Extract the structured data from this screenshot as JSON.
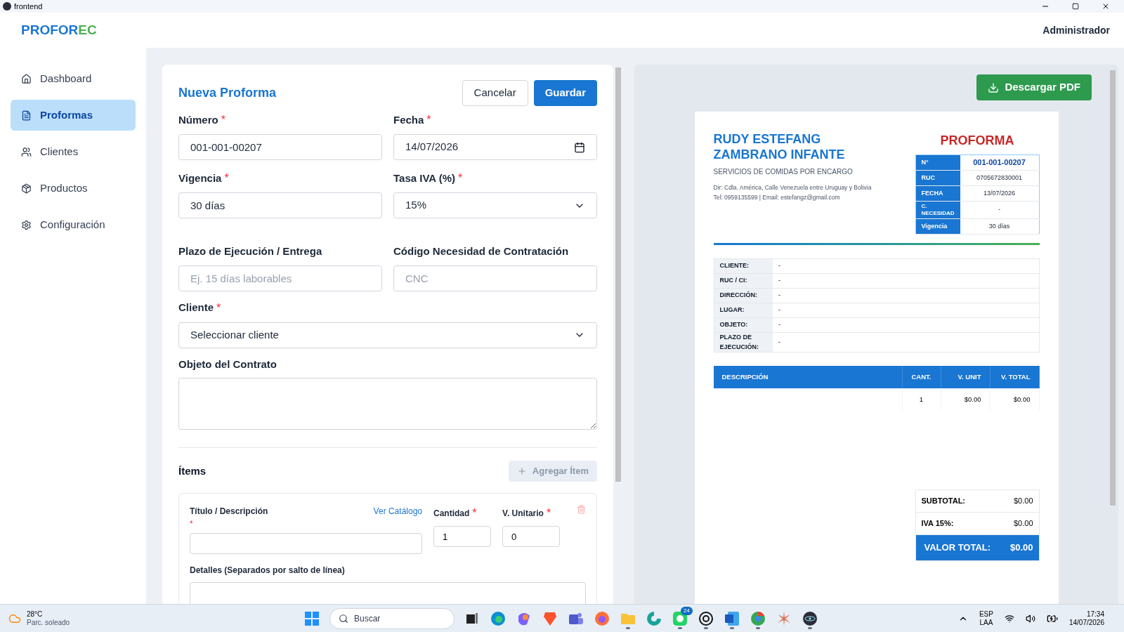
{
  "window": {
    "title": "frontend"
  },
  "app": {
    "logo_main": "PROFOR",
    "logo_accent": "EC",
    "user": "Administrador"
  },
  "sidebar": {
    "items": [
      {
        "label": "Dashboard",
        "kind": "home",
        "selected": false
      },
      {
        "label": "Proformas",
        "kind": "file",
        "selected": true
      },
      {
        "label": "Clientes",
        "kind": "users",
        "selected": false
      },
      {
        "label": "Productos",
        "kind": "box",
        "selected": false
      },
      {
        "label": "Configuración",
        "kind": "gear",
        "selected": false
      }
    ]
  },
  "form": {
    "title": "Nueva Proforma",
    "cancel": "Cancelar",
    "save": "Guardar",
    "fields": [
      {
        "label": "Número",
        "required_mark": "*",
        "kind": "text",
        "value": "001-001-00207"
      },
      {
        "label": "Fecha",
        "required_mark": "*",
        "kind": "date",
        "value": "14/07/2026"
      },
      {
        "label": "Vigencia",
        "required_mark": "*",
        "kind": "text",
        "value": "30 días"
      },
      {
        "label": "Tasa IVA (%)",
        "required_mark": "*",
        "kind": "select",
        "value": "15%"
      },
      {
        "label": "Plazo de Ejecución / Entrega",
        "kind": "text",
        "placeholder": "Ej. 15 días laborables"
      },
      {
        "label": "Código Necesidad de Contratación",
        "kind": "text",
        "placeholder": "CNC"
      }
    ],
    "client": {
      "label": "Cliente",
      "required_mark": "*",
      "value": "Seleccionar cliente"
    },
    "object": {
      "label": "Objeto del Contrato"
    },
    "items_title": "Ítems",
    "add_item": {
      "label": "Agregar Ítem",
      "disabled": true
    },
    "item": {
      "title_label": "Título / Descripción",
      "title_mark": "*",
      "catalog": "Ver Catálogo",
      "qty_label": "Cantidad",
      "qty_mark": "*",
      "qty": "1",
      "price_label": "V. Unitario",
      "price_mark": "*",
      "price": "0",
      "details_label": "Detalles (Separados por salto de línea)"
    }
  },
  "preview": {
    "download": "Descargar PDF",
    "company": {
      "name": "RUDY ESTEFANG ZAMBRANO INFANTE",
      "activity": "SERVICIOS DE COMIDAS POR ENCARGO",
      "address": "Dir: Cdla. América, Calle Venezuela entre Uruguay y Bolivia",
      "contact": "Tel: 0959135599 | Email: estefangz@gmail.com"
    },
    "doc_title": "PROFORMA",
    "meta": [
      {
        "label": "N°",
        "value": "001-001-00207",
        "kind": "number"
      },
      {
        "label": "RUC",
        "value": "0705672830001",
        "kind": "plain"
      },
      {
        "label": "FECHA",
        "value": "13/07/2026",
        "kind": "plain"
      },
      {
        "label": "C. NECESIDAD",
        "value": "-",
        "kind": "small"
      },
      {
        "label": "Vigencia",
        "value": "30 días",
        "kind": "plain"
      }
    ],
    "client_rows": [
      {
        "label": "CLIENTE:",
        "value": "-"
      },
      {
        "label": "RUC / CI:",
        "value": "-"
      },
      {
        "label": "DIRECCIÓN:",
        "value": "-"
      },
      {
        "label": "LUGAR:",
        "value": "-"
      },
      {
        "label": "OBJETO:",
        "value": "-"
      },
      {
        "label": "PLAZO DE EJECUCIÓN:",
        "value": "-"
      }
    ],
    "table": {
      "columns": [
        "DESCRIPCIÓN",
        "CANT.",
        "V. UNIT",
        "V. TOTAL"
      ],
      "rows": [
        [
          "",
          "1",
          "$0.00",
          "$0.00"
        ]
      ]
    },
    "totals": [
      {
        "label": "SUBTOTAL:",
        "value": "$0.00",
        "kind": "line"
      },
      {
        "label": "IVA 15%:",
        "value": "$0.00",
        "kind": "line"
      },
      {
        "label": "VALOR TOTAL:",
        "value": "$0.00",
        "kind": "grand"
      }
    ]
  },
  "taskbar": {
    "weather": {
      "temp": "28°C",
      "desc": "Parc. soleado"
    },
    "search": "Buscar",
    "apps": [
      {
        "kind": "start",
        "running": false
      },
      {
        "kind": "taskview",
        "running": false
      },
      {
        "kind": "edge",
        "running": false
      },
      {
        "kind": "copilot",
        "running": false
      },
      {
        "kind": "brave",
        "running": false
      },
      {
        "kind": "teams",
        "running": false
      },
      {
        "kind": "firefox",
        "running": false
      },
      {
        "kind": "folder",
        "running": true
      },
      {
        "kind": "wave",
        "running": false
      },
      {
        "kind": "whatsapp",
        "running": true,
        "badge": "24"
      },
      {
        "kind": "knot",
        "running": true
      },
      {
        "kind": "word",
        "running": true
      },
      {
        "kind": "chrome",
        "running": true
      },
      {
        "kind": "spark",
        "running": false
      },
      {
        "kind": "electron",
        "running": true
      }
    ],
    "lang": "ESP",
    "layout": "LAA",
    "time": "17:34",
    "date": "14/07/2026"
  }
}
